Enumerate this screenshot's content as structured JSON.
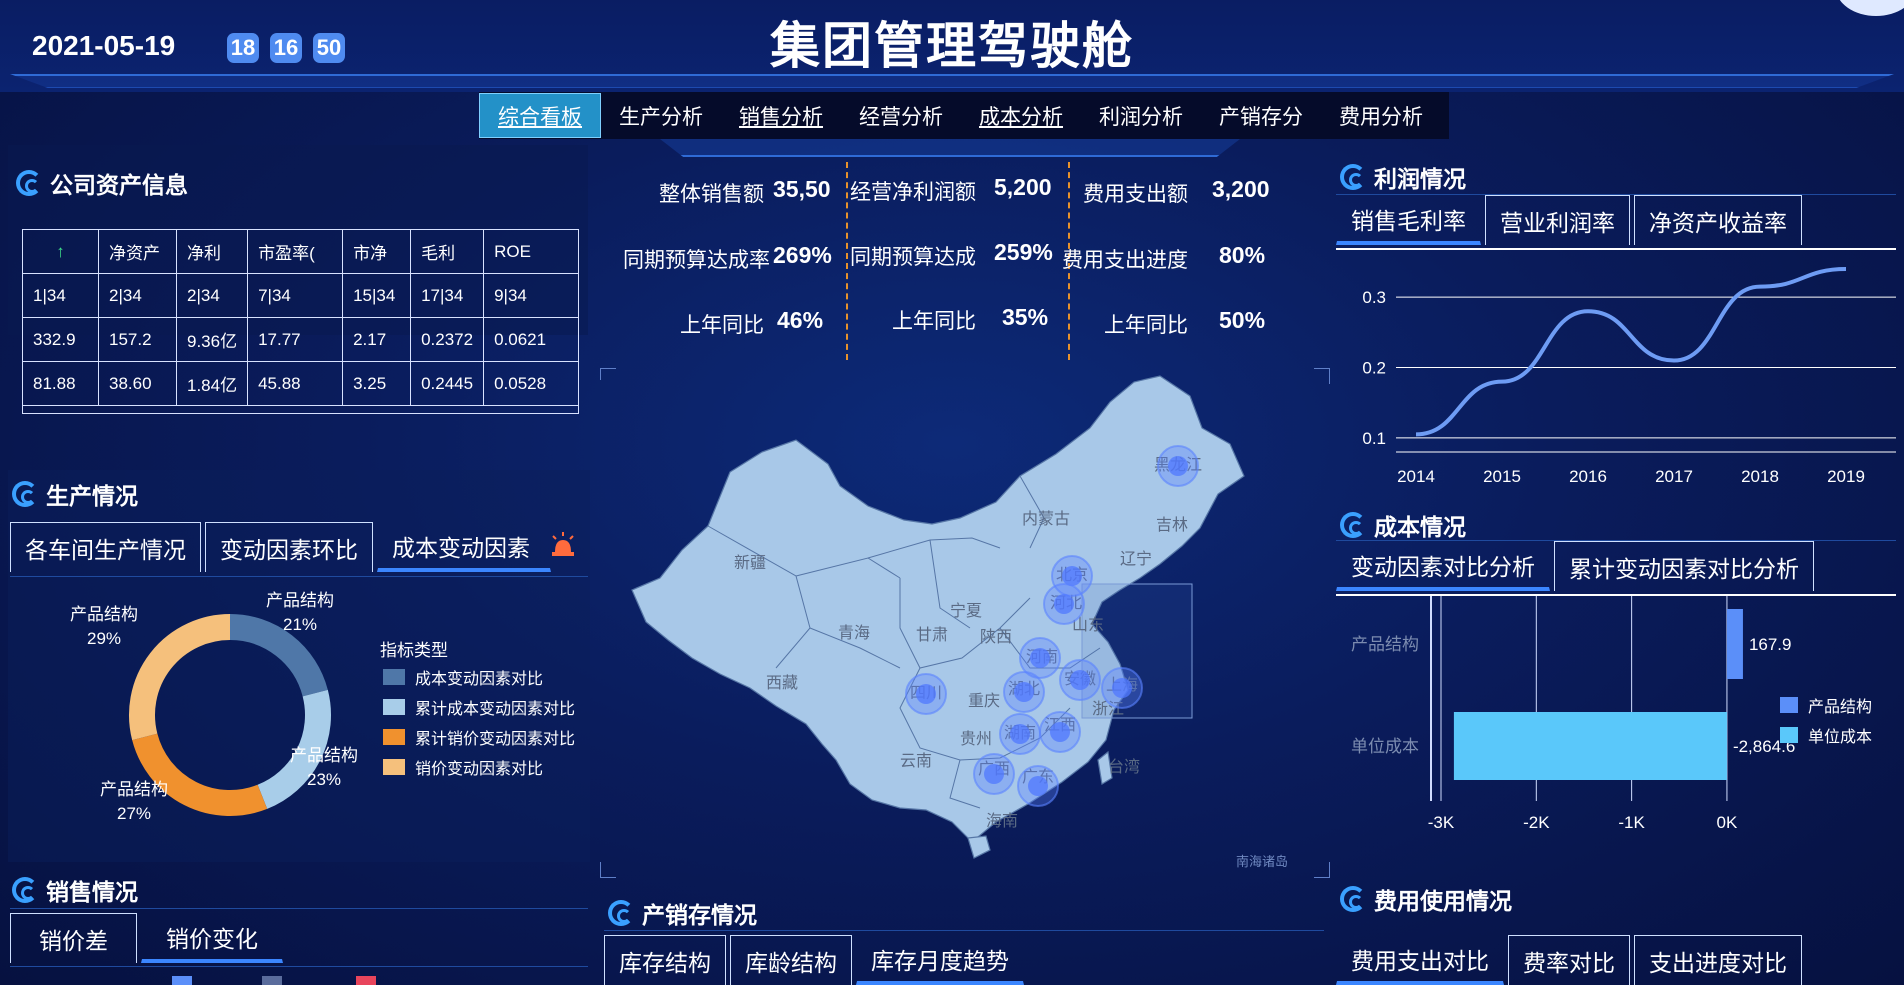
{
  "header": {
    "date": "2021-05-19",
    "time": [
      "18",
      "16",
      "50"
    ],
    "title": "集团管理驾驶舱"
  },
  "nav": {
    "tabs": [
      {
        "label": "综合看板",
        "active": true
      },
      {
        "label": "生产分析"
      },
      {
        "label": "销售分析"
      },
      {
        "label": "经营分析"
      },
      {
        "label": "成本分析"
      },
      {
        "label": "利润分析"
      },
      {
        "label": "产销存分"
      },
      {
        "label": "费用分析"
      }
    ]
  },
  "asset": {
    "title": "公司资产信息",
    "columns": [
      "↑",
      "净资产",
      "净利",
      "市盈率(",
      "市净",
      "毛利",
      "ROE"
    ],
    "rows": [
      [
        "1|34",
        "2|34",
        "2|34",
        "7|34",
        "15|34",
        "17|34",
        "9|34"
      ],
      [
        "332.9",
        "157.2",
        "9.36亿",
        "17.77",
        "2.17",
        "0.2372",
        "0.0621"
      ],
      [
        "81.88",
        "38.60",
        "1.84亿",
        "45.88",
        "3.25",
        "0.2445",
        "0.0528"
      ]
    ]
  },
  "production": {
    "title": "生产情况",
    "tabs": [
      "各车间生产情况",
      "变动因素环比",
      "成本变动因素"
    ],
    "legend_title": "指标类型",
    "legend": [
      {
        "name": "成本变动因素对比",
        "color": "#4f77a8"
      },
      {
        "name": "累计成本变动因素对比",
        "color": "#a8cde9"
      },
      {
        "name": "累计销价变动因素对比",
        "color": "#f0912e"
      },
      {
        "name": "销价变动因素对比",
        "color": "#f5c07c"
      }
    ],
    "labels": [
      {
        "name": "产品结构",
        "pct": "21%"
      },
      {
        "name": "产品结构",
        "pct": "23%"
      },
      {
        "name": "产品结构",
        "pct": "27%"
      },
      {
        "name": "产品结构",
        "pct": "29%"
      }
    ]
  },
  "sales": {
    "title": "销售情况",
    "tabs": [
      "销价差",
      "销价变化"
    ]
  },
  "kpis": {
    "col1": [
      {
        "label": "整体销售额",
        "value": "35,50"
      },
      {
        "label": "同期预算达成率",
        "value": "269%"
      },
      {
        "label": "上年同比",
        "value": "46%"
      }
    ],
    "col2": [
      {
        "label": "经营净利润额",
        "value": "5,200"
      },
      {
        "label": "同期预算达成",
        "value": "259%"
      },
      {
        "label": "上年同比",
        "value": "35%"
      }
    ],
    "col3": [
      {
        "label": "费用支出额",
        "value": "3,200"
      },
      {
        "label": "费用支出进度",
        "value": "80%"
      },
      {
        "label": "上年同比",
        "value": "50%"
      }
    ]
  },
  "map": {
    "provinces": [
      {
        "name": "黑龙江"
      },
      {
        "name": "吉林"
      },
      {
        "name": "辽宁"
      },
      {
        "name": "内蒙古"
      },
      {
        "name": "新疆"
      },
      {
        "name": "北京"
      },
      {
        "name": "河北"
      },
      {
        "name": "山东"
      },
      {
        "name": "宁夏"
      },
      {
        "name": "青海"
      },
      {
        "name": "甘肃"
      },
      {
        "name": "陕西"
      },
      {
        "name": "西藏"
      },
      {
        "name": "河南"
      },
      {
        "name": "安徽"
      },
      {
        "name": "四川"
      },
      {
        "name": "湖北"
      },
      {
        "name": "上海"
      },
      {
        "name": "重庆"
      },
      {
        "name": "浙江"
      },
      {
        "name": "贵州"
      },
      {
        "name": "湖南"
      },
      {
        "name": "江西"
      },
      {
        "name": "云南"
      },
      {
        "name": "广西"
      },
      {
        "name": "广东"
      },
      {
        "name": "台湾"
      },
      {
        "name": "海南"
      }
    ],
    "inset_label": "南海诸岛"
  },
  "inventory": {
    "title": "产销存情况",
    "tabs": [
      "库存结构",
      "库龄结构",
      "库存月度趋势"
    ]
  },
  "profit": {
    "title": "利润情况",
    "tabs": [
      "销售毛利率",
      "营业利润率",
      "净资产收益率"
    ]
  },
  "cost": {
    "title": "成本情况",
    "tabs": [
      "变动因素对比分析",
      "累计变动因素对比分析"
    ],
    "legend": [
      {
        "name": "产品结构",
        "color": "#5b8ff9"
      },
      {
        "name": "单位成本",
        "color": "#5ac8fa"
      }
    ]
  },
  "expense": {
    "title": "费用使用情况",
    "tabs": [
      "费用支出对比",
      "费率对比",
      "支出进度对比"
    ]
  },
  "chart_data": [
    {
      "type": "line",
      "x": [
        "2014",
        "2015",
        "2016",
        "2017",
        "2018",
        "2019"
      ],
      "series": [
        {
          "values": [
            0.105,
            0.18,
            0.28,
            0.21,
            0.315,
            0.34
          ]
        }
      ],
      "ylim": [
        0.08,
        0.35
      ],
      "yticks": [
        "0.1",
        "0.2",
        "0.3"
      ],
      "grid": true,
      "color": "#6e9cf4"
    },
    {
      "type": "bar",
      "orientation": "horizontal",
      "categories": [
        "产品结构",
        "单位成本"
      ],
      "values": [
        167.9,
        -2864.6
      ],
      "value_labels": [
        "167.9",
        "-2,864.6"
      ],
      "colors": [
        "#5b8ff9",
        "#5ac8fa"
      ],
      "xlim": [
        -3000,
        200
      ],
      "xticks": [
        "-3K",
        "-2K",
        "-1K",
        "0K"
      ],
      "legend": "right"
    },
    {
      "type": "pie",
      "categories": [
        "成本变动因素对比",
        "累计成本变动因素对比",
        "累计销价变动因素对比",
        "销价变动因素对比"
      ],
      "values": [
        21,
        23,
        27,
        29
      ],
      "colors": [
        "#4f77a8",
        "#a8cde9",
        "#f0912e",
        "#f5c07c"
      ],
      "donut": true
    }
  ]
}
